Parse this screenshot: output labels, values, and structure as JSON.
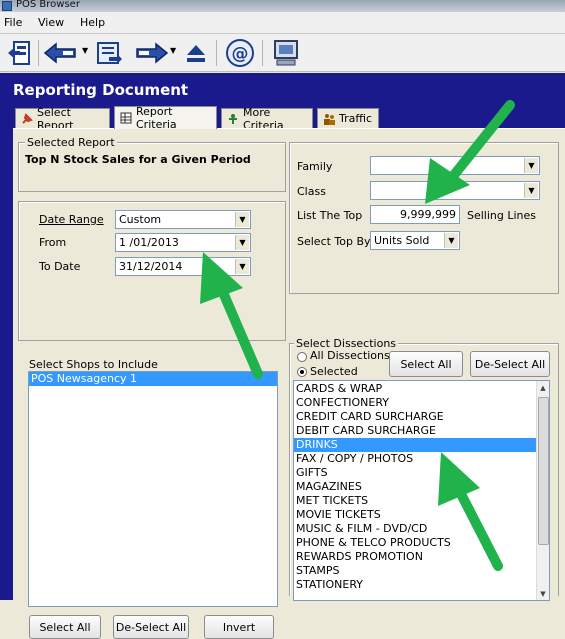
{
  "window": {
    "title": "POS Browser"
  },
  "menu": [
    {
      "label": "File"
    },
    {
      "label": "View"
    },
    {
      "label": "Help"
    }
  ],
  "header": {
    "title": "Reporting Document"
  },
  "tabs": [
    {
      "label": "Select Report"
    },
    {
      "label": "Report Criteria"
    },
    {
      "label": "More Criteria"
    },
    {
      "label": "Traffic"
    }
  ],
  "selected_report": {
    "legend": "Selected Report",
    "name": "Top N Stock Sales for a Given Period"
  },
  "date": {
    "range_label": "Date Range",
    "range_value": "Custom",
    "from_label": "From",
    "from_value": "1 /01/2013",
    "to_label": "To Date",
    "to_value": "31/12/2014"
  },
  "shops": {
    "label": "Select Shops to Include",
    "items": [
      "POS Newsagency 1"
    ],
    "select_all": "Select All",
    "deselect_all": "De-Select All",
    "invert": "Invert"
  },
  "criteria": {
    "family_label": "Family",
    "family_value": "",
    "class_label": "Class",
    "class_value": "",
    "top_label": "List The Top",
    "top_value": "9,999,999",
    "top_suffix": "Selling Lines",
    "top_by_label": "Select Top By",
    "top_by_value": "Units Sold"
  },
  "dissections": {
    "legend": "Select Dissections",
    "all_label": "All Dissections",
    "selected_label": "Selected",
    "selected_mode": "Selected",
    "select_all": "Select All",
    "deselect_all": "De-Select All",
    "items": [
      "CARDS & WRAP",
      "CONFECTIONERY",
      "CREDIT CARD SURCHARGE",
      "DEBIT CARD SURCHARGE",
      "DRINKS",
      "FAX / COPY / PHOTOS",
      "GIFTS",
      "MAGAZINES",
      "MET TICKETS",
      "MOVIE TICKETS",
      "MUSIC & FILM - DVD/CD",
      "PHONE & TELCO PRODUCTS",
      "REWARDS PROMOTION",
      "STAMPS",
      "STATIONERY"
    ],
    "selected_item": "DRINKS"
  },
  "colors": {
    "accent": "#1a1a8c",
    "selection": "#3399ff",
    "annotation_arrow": "#22b24c"
  }
}
